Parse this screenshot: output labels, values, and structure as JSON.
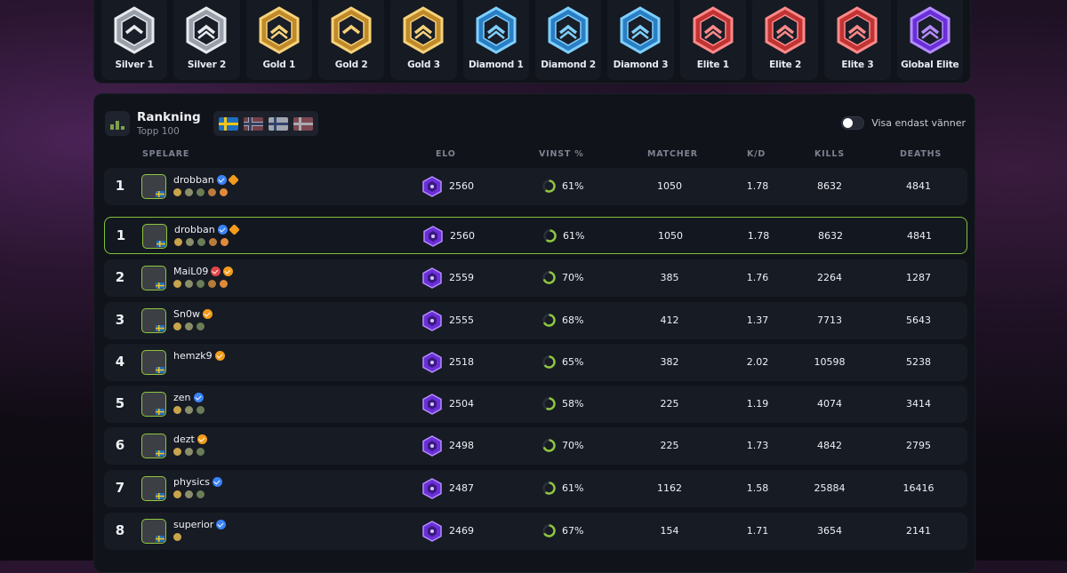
{
  "colors": {
    "accent": "#8ec63f",
    "elite": "#e04646",
    "diamond": "#3fa9e8",
    "gold": "#e0b24a",
    "silver": "#c9ccd2",
    "global": "#7b3fe4"
  },
  "tiers": [
    {
      "name": "Silver 1",
      "icon": "silver-1-rank-icon"
    },
    {
      "name": "Silver 2",
      "icon": "silver-2-rank-icon"
    },
    {
      "name": "Gold 1",
      "icon": "gold-1-rank-icon"
    },
    {
      "name": "Gold 2",
      "icon": "gold-2-rank-icon"
    },
    {
      "name": "Gold 3",
      "icon": "gold-3-rank-icon"
    },
    {
      "name": "Diamond 1",
      "icon": "diamond-1-rank-icon"
    },
    {
      "name": "Diamond 2",
      "icon": "diamond-2-rank-icon"
    },
    {
      "name": "Diamond 3",
      "icon": "diamond-3-rank-icon"
    },
    {
      "name": "Elite 1",
      "icon": "elite-1-rank-icon"
    },
    {
      "name": "Elite 2",
      "icon": "elite-2-rank-icon"
    },
    {
      "name": "Elite 3",
      "icon": "elite-3-rank-icon"
    },
    {
      "name": "Global Elite",
      "icon": "global-elite-rank-icon"
    }
  ],
  "ranking": {
    "title": "Rankning",
    "subtitle": "Topp 100",
    "flags": [
      "sweden-flag",
      "norway-flag",
      "finland-flag",
      "denmark-flag"
    ],
    "friends_toggle_label": "Visa endast vänner",
    "friends_toggle_on": false
  },
  "columns": {
    "player": "SPELARE",
    "elo": "ELO",
    "win": "VINST %",
    "matches": "MATCHER",
    "kd": "K/D",
    "kills": "KILLS",
    "deaths": "DEATHS"
  },
  "players": [
    {
      "rank": "1",
      "name": "drobban",
      "elo": "2560",
      "win": "61%",
      "win_value": 61,
      "matches": "1050",
      "kd": "1.78",
      "kills": "8632",
      "deaths": "4841",
      "badges": [
        "verified",
        "diamond"
      ],
      "trophies": 5,
      "highlight": false
    },
    {
      "rank": "1",
      "name": "drobban",
      "elo": "2560",
      "win": "61%",
      "win_value": 61,
      "matches": "1050",
      "kd": "1.78",
      "kills": "8632",
      "deaths": "4841",
      "badges": [
        "verified",
        "diamond"
      ],
      "trophies": 5,
      "highlight": true
    },
    {
      "rank": "2",
      "name": "MaiL09",
      "elo": "2559",
      "win": "70%",
      "win_value": 70,
      "matches": "385",
      "kd": "1.76",
      "kills": "2264",
      "deaths": "1287",
      "badges": [
        "red",
        "orange"
      ],
      "trophies": 5,
      "highlight": false
    },
    {
      "rank": "3",
      "name": "Sn0w",
      "elo": "2555",
      "win": "68%",
      "win_value": 68,
      "matches": "412",
      "kd": "1.37",
      "kills": "7713",
      "deaths": "5643",
      "badges": [
        "orange"
      ],
      "trophies": 3,
      "highlight": false
    },
    {
      "rank": "4",
      "name": "hemzk9",
      "elo": "2518",
      "win": "65%",
      "win_value": 65,
      "matches": "382",
      "kd": "2.02",
      "kills": "10598",
      "deaths": "5238",
      "badges": [
        "orange"
      ],
      "trophies": 0,
      "highlight": false
    },
    {
      "rank": "5",
      "name": "zen",
      "elo": "2504",
      "win": "58%",
      "win_value": 58,
      "matches": "225",
      "kd": "1.19",
      "kills": "4074",
      "deaths": "3414",
      "badges": [
        "verified"
      ],
      "trophies": 3,
      "highlight": false
    },
    {
      "rank": "6",
      "name": "dezt",
      "elo": "2498",
      "win": "70%",
      "win_value": 70,
      "matches": "225",
      "kd": "1.73",
      "kills": "4842",
      "deaths": "2795",
      "badges": [
        "orange"
      ],
      "trophies": 3,
      "highlight": false
    },
    {
      "rank": "7",
      "name": "physics",
      "elo": "2487",
      "win": "61%",
      "win_value": 61,
      "matches": "1162",
      "kd": "1.58",
      "kills": "25884",
      "deaths": "16416",
      "badges": [
        "verified"
      ],
      "trophies": 3,
      "highlight": false
    },
    {
      "rank": "8",
      "name": "superior",
      "elo": "2469",
      "win": "67%",
      "win_value": 67,
      "matches": "154",
      "kd": "1.71",
      "kills": "3654",
      "deaths": "2141",
      "badges": [
        "verified"
      ],
      "trophies": 1,
      "highlight": false
    }
  ]
}
